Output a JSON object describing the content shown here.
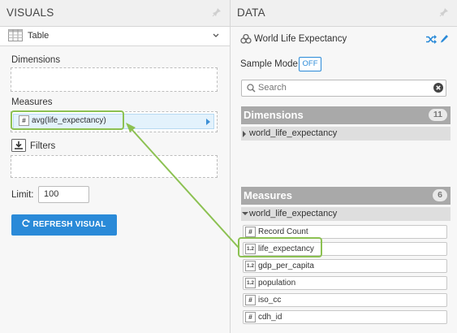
{
  "visuals": {
    "title": "VISUALS",
    "visual_type": "Table",
    "dimensions_label": "Dimensions",
    "measures_label": "Measures",
    "measure_chip": "avg(life_expectancy)",
    "measure_chip_type": "#",
    "filters_label": "Filters",
    "limit_label": "Limit:",
    "limit_value": "100",
    "refresh_button": "REFRESH VISUAL"
  },
  "data": {
    "title": "DATA",
    "dataset_name": "World Life Expectancy",
    "sample_mode_label": "Sample Mode:",
    "sample_mode_value": "OFF",
    "search_placeholder": "Search",
    "dimensions_header": "Dimensions",
    "dimensions_count": "11",
    "dimensions_group": "world_life_expectancy",
    "measures_header": "Measures",
    "measures_count": "6",
    "measures_group": "world_life_expectancy",
    "measures": [
      {
        "type": "#",
        "name": "Record Count"
      },
      {
        "type": "1.2",
        "name": "life_expectancy"
      },
      {
        "type": "1.2",
        "name": "gdp_per_capita"
      },
      {
        "type": "1.2",
        "name": "population"
      },
      {
        "type": "#",
        "name": "iso_cc"
      },
      {
        "type": "#",
        "name": "cdh_id"
      }
    ]
  },
  "colors": {
    "accent": "#2a8ad8",
    "highlight": "#8cc152",
    "section_header": "#a9a9a9"
  }
}
